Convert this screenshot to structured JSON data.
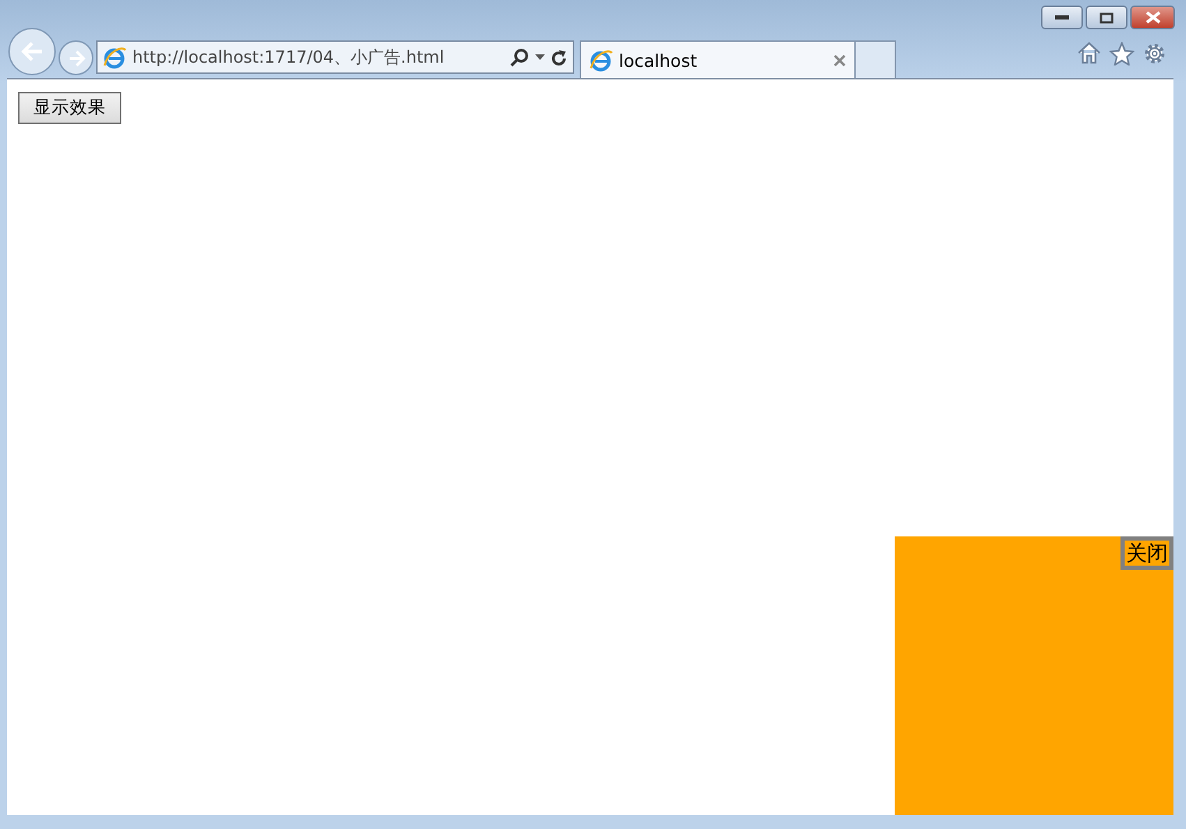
{
  "browser": {
    "address": "http://localhost:1717/04、小广告.html",
    "tabs": [
      {
        "label": "localhost",
        "selected": true
      }
    ]
  },
  "page": {
    "button": "显示效果",
    "ad": {
      "close": "关闭"
    }
  }
}
